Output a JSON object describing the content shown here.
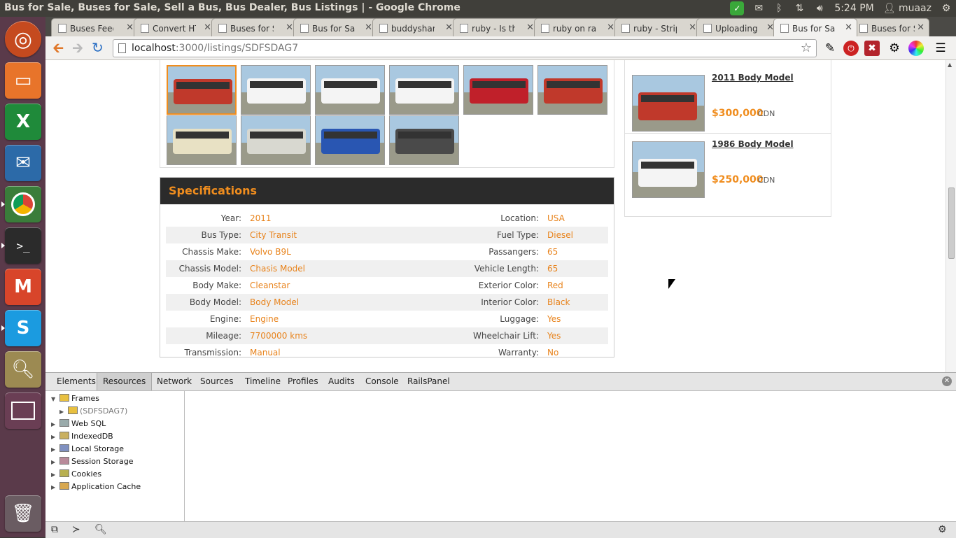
{
  "window": {
    "title": "Bus for Sale, Buses for Sale, Sell a Bus, Bus Dealer, Bus Listings | - Google Chrome"
  },
  "tray": {
    "time": "5:24 PM",
    "user": "muaaz"
  },
  "tabs": [
    {
      "label": "Buses Feed"
    },
    {
      "label": "Convert HT"
    },
    {
      "label": "Buses for S"
    },
    {
      "label": "Bus for Sal"
    },
    {
      "label": "buddyshari"
    },
    {
      "label": "ruby - Is th"
    },
    {
      "label": "ruby on rai"
    },
    {
      "label": "ruby - Strip"
    },
    {
      "label": "Uploading"
    },
    {
      "label": "Bus for Sal",
      "active": true
    },
    {
      "label": "Buses for S"
    }
  ],
  "omnibox": {
    "host": "localhost",
    "path": ":3000/listings/SDFSDAG7"
  },
  "gallery": {
    "thumbs": [
      {
        "color": "#c0392b"
      },
      {
        "color": "#f4f4f4"
      },
      {
        "color": "#f4f4f4"
      },
      {
        "color": "#f4f4f4"
      },
      {
        "color": "#c0202a"
      },
      {
        "color": "#c0392b"
      },
      {
        "color": "#e8e1c4"
      },
      {
        "color": "#d8d8d0"
      },
      {
        "color": "#2956b2"
      },
      {
        "color": "#4a4a4a"
      }
    ]
  },
  "specs": {
    "heading": "Specifications",
    "rows": [
      {
        "lk": "Year:",
        "lv": "2011",
        "rk": "Location:",
        "rv": "USA"
      },
      {
        "lk": "Bus Type:",
        "lv": "City Transit",
        "rk": "Fuel Type:",
        "rv": "Diesel"
      },
      {
        "lk": "Chassis Make:",
        "lv": "Volvo B9L",
        "rk": "Passangers:",
        "rv": "65"
      },
      {
        "lk": "Chassis Model:",
        "lv": "Chasis Model",
        "rk": "Vehicle Length:",
        "rv": "65"
      },
      {
        "lk": "Body Make:",
        "lv": "Cleanstar",
        "rk": "Exterior Color:",
        "rv": "Red"
      },
      {
        "lk": "Body Model:",
        "lv": "Body Model",
        "rk": "Interior Color:",
        "rv": "Black"
      },
      {
        "lk": "Engine:",
        "lv": "Engine",
        "rk": "Luggage:",
        "rv": "Yes"
      },
      {
        "lk": "Mileage:",
        "lv": "7700000 kms",
        "rk": "Wheelchair Lift:",
        "rv": "Yes"
      },
      {
        "lk": "Transmission:",
        "lv": "Manual",
        "rk": "Warranty:",
        "rv": "No"
      }
    ]
  },
  "similar": [
    {
      "title": "2011 Body Model",
      "price": "$300,000",
      "currency": "CDN"
    },
    {
      "title": "1986 Body Model",
      "price": "$250,000",
      "currency": "CDN"
    }
  ],
  "devtools": {
    "tabs": [
      "Elements",
      "Resources",
      "Network",
      "Sources",
      "Timeline",
      "Profiles",
      "Audits",
      "Console",
      "RailsPanel"
    ],
    "active_tab": "Resources",
    "tree": [
      {
        "label": "Frames",
        "expanded": true
      },
      {
        "label": "(SDFSDAG7)",
        "child": true
      },
      {
        "label": "Web SQL"
      },
      {
        "label": "IndexedDB"
      },
      {
        "label": "Local Storage"
      },
      {
        "label": "Session Storage"
      },
      {
        "label": "Cookies"
      },
      {
        "label": "Application Cache"
      }
    ]
  }
}
